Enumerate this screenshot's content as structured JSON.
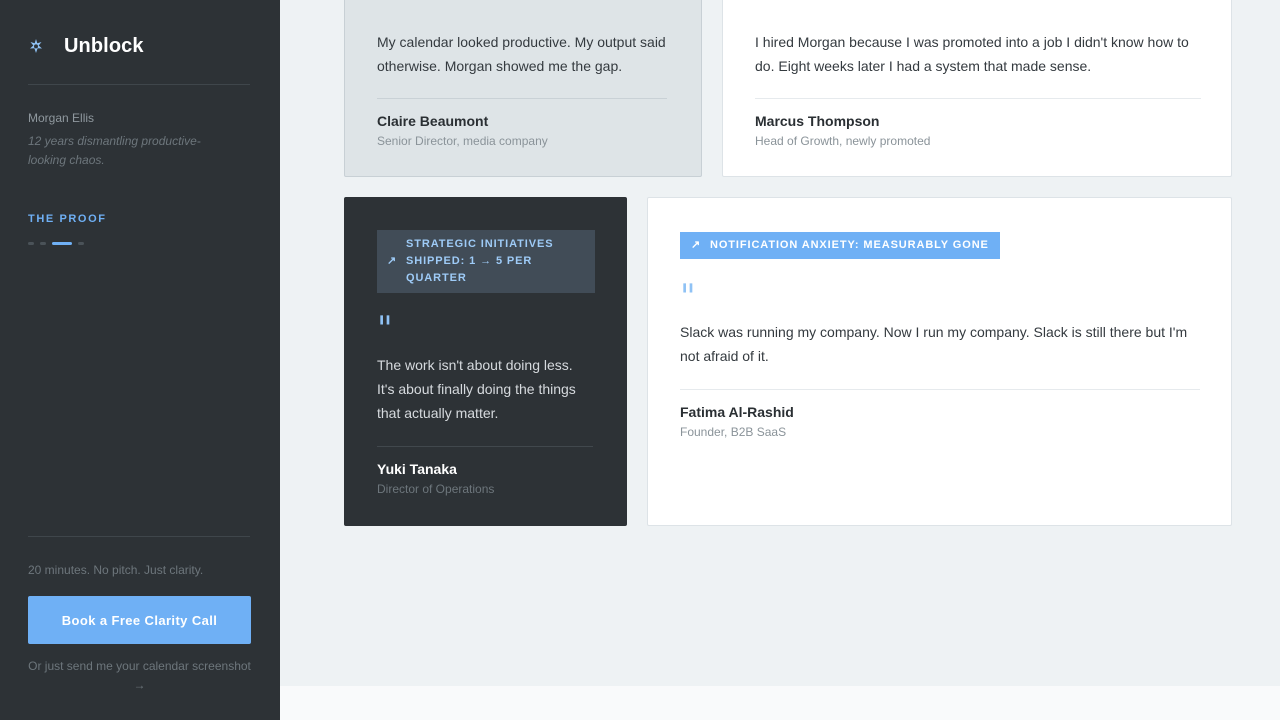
{
  "sidebar": {
    "brand": {
      "name": "Unblock",
      "icon": "sparkle-icon"
    },
    "author": {
      "name": "Morgan Ellis",
      "tagline": "12 years dismantling productive-looking chaos."
    },
    "section_label": "THE PROOF",
    "progress": {
      "total": 4,
      "active_index": 2
    },
    "cta": {
      "note": "20 minutes. No pitch. Just clarity.",
      "button_label": "Book a Free Clarity Call",
      "alt_link": "Or just send me your calendar screenshot →"
    }
  },
  "testimonials": [
    {
      "quote_mark": "\"",
      "quote": "My calendar looked productive. My output said otherwise. Morgan showed me the gap.",
      "name": "Claire Beaumont",
      "role": "Senior Director, media company"
    },
    {
      "quote_mark": "\"",
      "quote": "I hired Morgan because I was promoted into a job I didn't know how to do. Eight weeks later I had a system that made sense.",
      "name": "Marcus Thompson",
      "role": "Head of Growth, newly promoted"
    },
    {
      "badge": "STRATEGIC INITIATIVES SHIPPED: 1 → 5 PER QUARTER",
      "badge_icon": "trend-arrow-icon",
      "quote_mark": "\"",
      "quote": "The work isn't about doing less. It's about finally doing the things that actually matter.",
      "name": "Yuki Tanaka",
      "role": "Director of Operations"
    },
    {
      "badge": "NOTIFICATION ANXIETY: MEASURABLY GONE",
      "badge_icon": "trend-arrow-icon",
      "quote_mark": "\"",
      "quote": "Slack was running my company. Now I run my company. Slack is still there but I'm not afraid of it.",
      "name": "Fatima Al-Rashid",
      "role": "Founder, B2B SaaS"
    }
  ],
  "colors": {
    "sidebar_bg": "#2d3236",
    "accent": "#6fb0f5",
    "page_bg": "#eef2f4"
  }
}
